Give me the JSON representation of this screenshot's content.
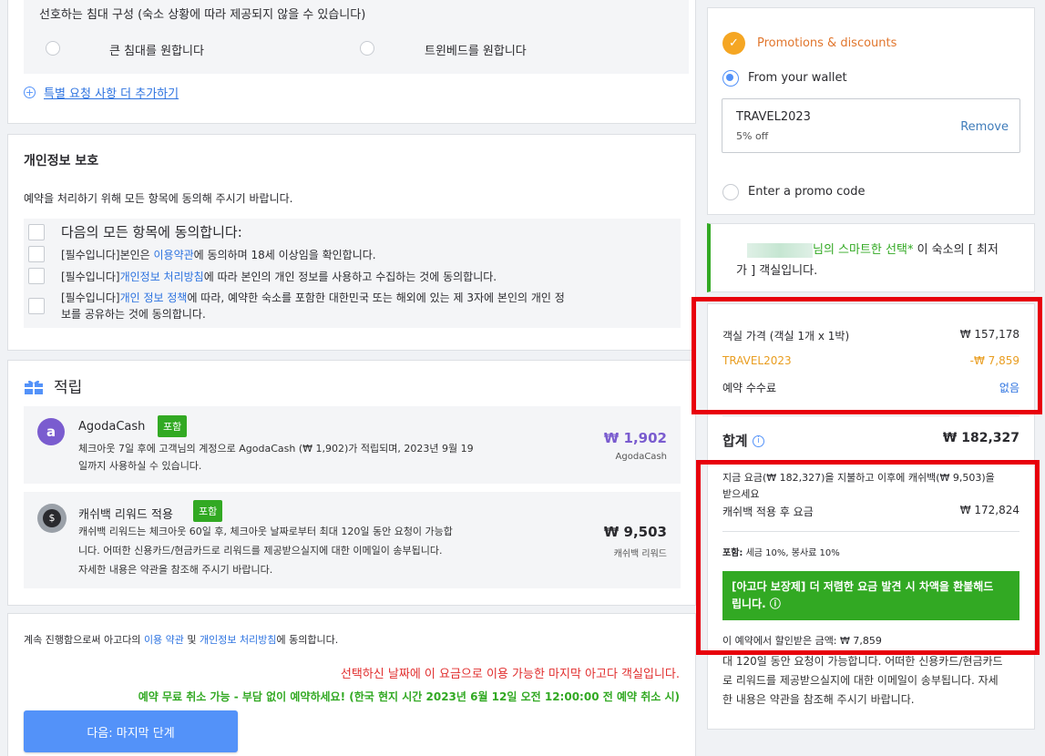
{
  "bed": {
    "title": "선호하는 침대 구성 (숙소 상황에 따라 제공되지 않을 수 있습니다)",
    "option_large": "큰 침대를 원합니다",
    "option_twin": "트윈베드를 원합니다",
    "add_request": "특별 요청 사항 더 추가하기"
  },
  "privacy": {
    "title": "개인정보 보호",
    "subtitle": "예약을 처리하기 위해 모든 항목에 동의해 주시기 바랍니다.",
    "agree_all": "다음의 모든 항목에 동의합니다:",
    "item1_prefix": "[필수입니다]본인은 ",
    "item1_link": "이용약관",
    "item1_suffix": "에 동의하며 18세 이상임을 확인합니다.",
    "item2_prefix": "[필수입니다]",
    "item2_link": "개인정보 처리방침",
    "item2_suffix": "에 따라 본인의 개인 정보를 사용하고 수집하는 것에 동의합니다.",
    "item3_prefix": "[필수입니다]",
    "item3_link": "개인 정보 정책",
    "item3_suffix": "에 따라, 예약한 숙소를 포함한 대한민국 또는 해외에 있는 제 3자에 본인의 개인 정",
    "item3_line2": "보를 공유하는 것에 동의합니다."
  },
  "rewards": {
    "title": "적립",
    "agodacash": {
      "name": "AgodaCash",
      "badge": "포함",
      "desc1": "체크아웃 7일 후에 고객님의 계정으로 AgodaCash (₩ 1,902)가 적립되며, 2023년 9월 19",
      "desc2": "일까지 사용하실 수 있습니다.",
      "amount": "₩ 1,902",
      "unit": "AgodaCash"
    },
    "cashback": {
      "name": "캐쉬백 리워드 적용",
      "badge": "포함",
      "desc1": "캐쉬백 리워드는 체크아웃 60일 후, 체크아웃 날짜로부터 최대 120일 동안 요청이 가능합",
      "desc2": "니다. 어떠한 신용카드/현금카드로 리워드를 제공받으실지에 대한 이메일이 송부됩니다.",
      "desc3": "자세한 내용은 약관을 참조해 주시기 바랍니다.",
      "amount": "₩ 9,503",
      "unit": "캐쉬백 리워드"
    }
  },
  "footer": {
    "consent_prefix": "계속 진행함으로써 아고다의 ",
    "consent_link1": "이용 약관",
    "consent_mid": " 및 ",
    "consent_link2": "개인정보 처리방침",
    "consent_suffix": "에 동의합니다.",
    "last_room": "선택하신 날짜에 이 요금으로 이용 가능한 마지막 아고다 객실입니다.",
    "free_cancel": "예약 무료 취소 가능 - 부담 없이 예약하세요! (한국 현지 시간 2023년 6월 12일 오전 12:00:00 전 예약 취소 시)",
    "next_button": "다음: 마지막 단계"
  },
  "promo": {
    "title": "Promotions & discounts",
    "wallet_label": "From your wallet",
    "code": "TRAVEL2023",
    "code_desc": "5% off",
    "remove": "Remove",
    "enter_code": "Enter a promo code"
  },
  "smart": {
    "name_suffix": "님의 스마트한 선택",
    "star": "*",
    "text1": " 이 숙소의 [ 최저",
    "text2": "가 ] 객실입니다."
  },
  "price": {
    "room_label": "객실 가격 (객실 1개 x 1박)",
    "room_value": "₩ 157,178",
    "promo_label": "TRAVEL2023",
    "promo_value": "-₩ 7,859",
    "fee_label": "예약 수수료",
    "fee_value": "없음",
    "total_label": "합계",
    "total_value": "₩ 182,327"
  },
  "cashback_panel": {
    "line1": "지금 요금(₩ 182,327)을 지불하고 이후에 캐쉬백(₩ 9,503)을",
    "line2": "받으세요",
    "after_label": "캐쉬백 적용 후 요금",
    "after_value": "₩ 172,824",
    "tax_label": "포함:",
    "tax_value": " 세금 10%, 봉사료 10%",
    "guarantee_bold": "[아고다 보장제]",
    "guarantee_text1": " 더 저렴한 요금 발견 시 차액을 환불해드",
    "guarantee_text2": "립니다. ⓘ",
    "discount_label": "이 예약에서 할인받은 금액: ₩ 7,859",
    "more1": "대 120일 동안 요청이 가능합니다. 어떠한 신용카드/현금카드",
    "more2": "로 리워드를 제공받으실지에 대한 이메일이 송부됩니다. 자세",
    "more3": "한 내용은 약관을 참조해 주시기 바랍니다."
  },
  "colors": {
    "accent": "#5392f9",
    "green": "#32a923",
    "orange": "#e99d1f",
    "red": "#e12d2d",
    "highlight_box": "#e8000b"
  }
}
